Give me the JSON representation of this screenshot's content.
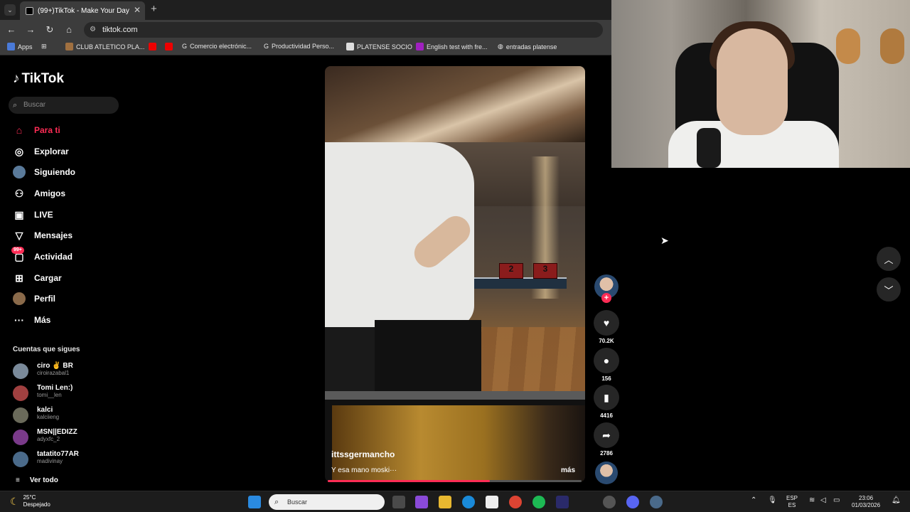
{
  "browser": {
    "tab_title": "(99+)TikTok - Make Your Day",
    "url": "tiktok.com",
    "bookmarks": [
      "Apps",
      "CLUB ATLETICO PLA...",
      "Comercio electrónic...",
      "Productividad Perso...",
      "PLATENSE SOCIO",
      "English test with fre...",
      "entradas platense"
    ]
  },
  "sidebar": {
    "logo": "TikTok",
    "search_placeholder": "Buscar",
    "nav": [
      {
        "label": "Para ti",
        "icon": "home-icon",
        "active": true
      },
      {
        "label": "Explorar",
        "icon": "compass-icon"
      },
      {
        "label": "Siguiendo",
        "icon": "following-avatar-icon"
      },
      {
        "label": "Amigos",
        "icon": "friends-icon"
      },
      {
        "label": "LIVE",
        "icon": "live-tv-icon"
      },
      {
        "label": "Mensajes",
        "icon": "messages-icon"
      },
      {
        "label": "Actividad",
        "icon": "activity-icon",
        "badge": "99+"
      },
      {
        "label": "Cargar",
        "icon": "upload-icon"
      },
      {
        "label": "Perfil",
        "icon": "profile-icon"
      },
      {
        "label": "Más",
        "icon": "more-icon"
      }
    ],
    "following_title": "Cuentas que sigues",
    "following": [
      {
        "name": "ciro ✌️ BR",
        "handle": "ciroirazabal1"
      },
      {
        "name": "Tomi Len:)",
        "handle": "tomi__len"
      },
      {
        "name": "kalci",
        "handle": "kalciieng"
      },
      {
        "name": "MSN||EDIZZ",
        "handle": "adyxfc_2"
      },
      {
        "name": "tatatito77AR",
        "handle": "madivinay"
      }
    ],
    "see_all": "Ver todo"
  },
  "video": {
    "author": "ittssgermancho",
    "caption": "Y esa mano moski···",
    "more": "más",
    "progress": 0.64,
    "panel_numbers": [
      "2",
      "3"
    ]
  },
  "actions": {
    "likes": "70.2K",
    "comments": "156",
    "saves": "4416",
    "shares": "2786"
  },
  "taskbar": {
    "temp": "25°C",
    "weather": "Despejado",
    "search_placeholder": "Buscar",
    "lang_top": "ESP",
    "lang_bottom": "ES",
    "time": "23:06",
    "date": "01/03/2026"
  },
  "colors": {
    "accent": "#fe2c55",
    "background": "#000000"
  }
}
